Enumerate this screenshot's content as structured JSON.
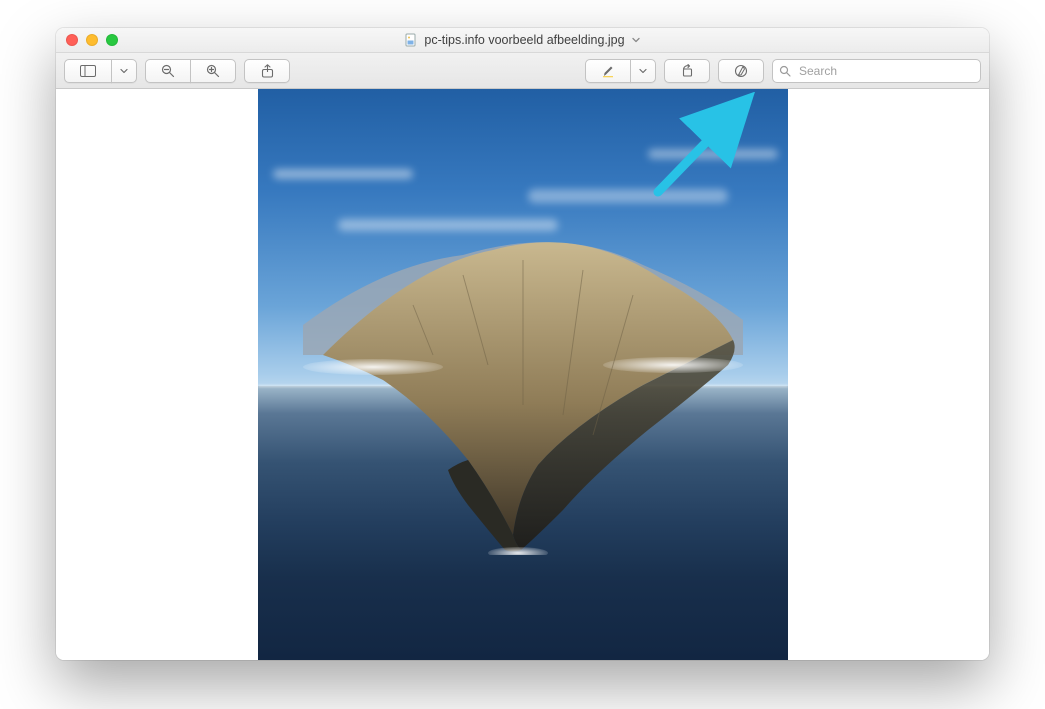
{
  "window": {
    "title": "pc-tips.info voorbeeld afbeelding.jpg"
  },
  "toolbar": {
    "sidebar_label": "Sidebar",
    "zoom_out_label": "Zoom Out",
    "zoom_in_label": "Zoom In",
    "share_label": "Share",
    "highlight_label": "Highlight",
    "highlight_menu_label": "Highlight options",
    "rotate_label": "Rotate Left",
    "markup_label": "Markup"
  },
  "search": {
    "placeholder": "Search",
    "value": ""
  },
  "annotation": {
    "arrow_color": "#28c2e6"
  }
}
